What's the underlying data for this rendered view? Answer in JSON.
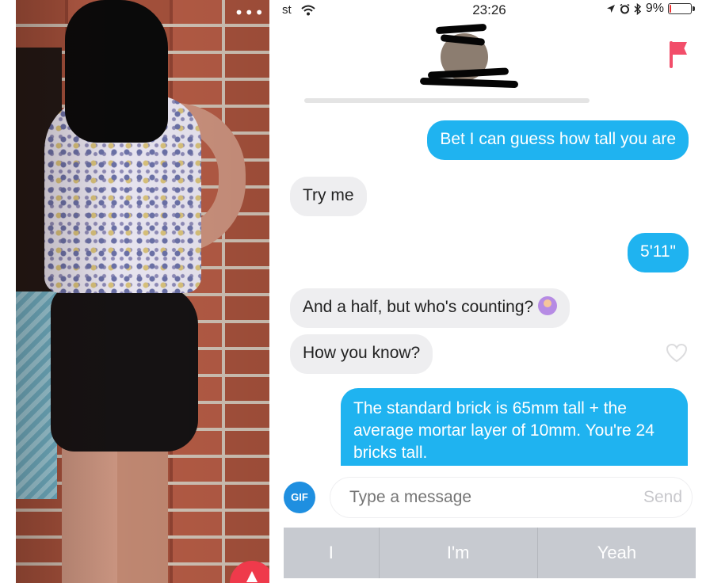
{
  "photo": {
    "menu_dots": "•••",
    "badge_icon": "flame-icon"
  },
  "status_bar": {
    "carrier": "st",
    "time": "23:26",
    "battery": "9%",
    "battery_level": 0.09,
    "icons": [
      "wifi-icon",
      "location-icon",
      "alarm-icon",
      "bluetooth-icon",
      "battery-icon"
    ]
  },
  "header": {
    "report_icon": "flag-icon",
    "accent": "#f24e6a"
  },
  "messages": [
    {
      "from": "me",
      "text": "Bet I can guess how tall you are"
    },
    {
      "from": "them",
      "text": "Try me"
    },
    {
      "from": "me",
      "text": "5'11\""
    },
    {
      "from": "them",
      "text": "And a half, but who's counting?"
    },
    {
      "from": "them",
      "text": "How you know?"
    },
    {
      "from": "me",
      "text": "The standard brick is 65mm tall + the average mortar layer of 10mm. You're 24 bricks tall."
    }
  ],
  "composer": {
    "gif_label": "GIF",
    "placeholder": "Type a message",
    "send_label": "Send"
  },
  "suggestions": [
    "I",
    "I'm",
    "Yeah"
  ],
  "colors": {
    "sent_bubble": "#1fb3f0",
    "received_bubble": "#eeeef0",
    "gif_button": "#1f8fe0"
  }
}
